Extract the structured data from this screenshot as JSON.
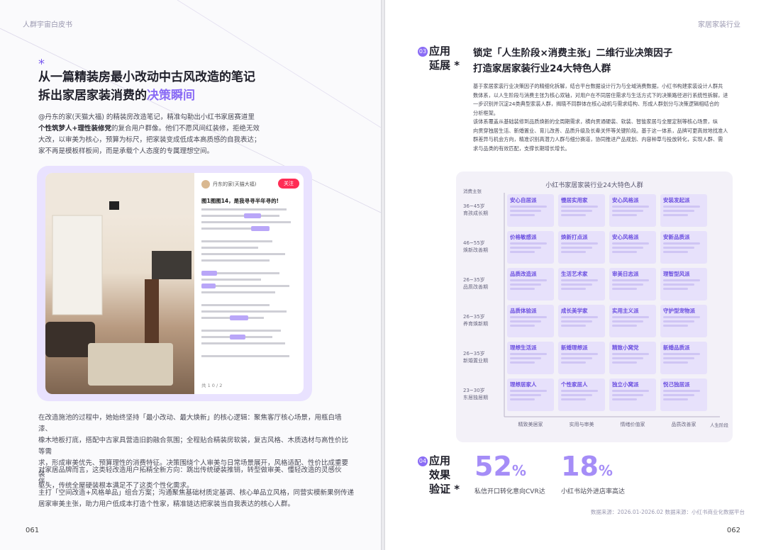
{
  "left_page": {
    "running_head": "人群宇宙白皮书",
    "heading_line1": "从一篇精装房最小改动中古风改造的笔记",
    "heading_line2_plain": "拆出家居家装消费的",
    "heading_line2_accent": "决策瞬间",
    "intro": {
      "p1": "@丹东的家(天猫大福) 的精装房改造笔记，精准勾勒出小红书家居赛道里",
      "p2_bold": "个性筑梦人+理性装修党",
      "p3": "的复合用户群像。他们不愿风间红装修，拒绝无效",
      "p4": "大改，以审美为核心，预算为标尺，把家装变成低成本高质感的自我表达；",
      "p5": "家不再是模板样板间，而是承载个人态度的专属理想空间。"
    },
    "note": {
      "author": "丹东的家(天猫大福)",
      "follow_label": "关注",
      "title": "图1图图14，是我寻寻半年寻的!",
      "footer": "共 1 0 / 2"
    },
    "para2": {
      "l1": "在改造施池的过程中，她始终坚持「最小改动、最大焕新」的核心逻辑：聚焦客厅核心场景，用瓶白墙漆、",
      "l2": "橡木地板打底，搭配中古家具营造旧韵融合氛围；全程贴合精装房软装，复古风格、木质选材与高性价比等需",
      "l3": "求，形成审美优先、预算理性的消费特征。决策围绕个人审美与日常场景展开，风格适配、性价比成重要装",
      "l4": "驱头，传统全屋硬装根本满足不了这类个性化需求。"
    },
    "para3": {
      "l1": "对家居品牌而言，这类轻改造用户拓精全新方向：跳出传统硬装推销，转型做审美、懂轻改造的灵感伙伴，",
      "l2": "主打「空间改造+风格单品」组合方案；沟通聚焦基础材质定基调、核心单品立风格，同营实模新果例传递",
      "l3": "居家审美主张，助力用户低成本打造个性家，精准链达把家装当自我表达的核心人群。"
    },
    "folio": "061"
  },
  "right_page": {
    "running_head": "家居家装行业",
    "sec3": {
      "no": "03",
      "title_l1": "应用",
      "title_l2": "延展 *"
    },
    "title_l1": "锁定「人生阶段×消费主张」二维行业决策因子",
    "title_l2": "打造家居家装行业24大特色人群",
    "body": {
      "l1": "基于家居家装行业决策因子的精细化拆解，结合平台数据设计行为与全域消费数据，小红书构建家装设计人群共",
      "l2": "数体系，以人生阶段与消费主张为核心双轴，对用户在不同居住需求与生活方式下的决策路径进行系统性拆解，进",
      "l3": "一步识别并沉淀24类典型家装人群，揭晓不同群体在核心动机与需求结构、形成人群划分与决策逻辑相结合的",
      "l4": "分析框架。",
      "l5": "该体系覆盖从基础装修到品质焕新的全周期需求，横向贯通硬装、软装、智能家居与全屋定制等核心场景，纵",
      "l6": "向贯穿独居生活、新婚置业、育儿改善、品质升级及长辈关怀等关键阶段。基于这一体系，品牌可更高效地找准人",
      "l7": "群差异与机会方向，精准识别高潜力人群与细分赛道，协同推进产品规划、内容种草与投放转化，实现人群、需",
      "l8": "求与品类的有效匹配，支撑长期增长增长。"
    },
    "grid": {
      "title": "小红书家居家装行业24大特色人群",
      "y_axis_title": "消费主张",
      "x_axis_title": "人生阶段",
      "rows": [
        {
          "label": "36~45岁\n育孩成长期",
          "cells": [
            "安心自居派",
            "慢居实用家",
            "安心风格派",
            "安装发起派"
          ]
        },
        {
          "label": "46~55岁\n焕新改善期",
          "cells": [
            "价格敏感派",
            "焕新打点派",
            "安心风格派",
            "安新品质派"
          ]
        },
        {
          "label": "26~35岁\n品质改善期",
          "cells": [
            "品质改造派",
            "生活艺术家",
            "审美日志派",
            "理智型风派"
          ]
        },
        {
          "label": "26~35岁\n养育焕新期",
          "cells": [
            "品质体验派",
            "成长美学家",
            "实用主义派",
            "守护型宠物派"
          ]
        },
        {
          "label": "26~35岁\n新婚置业期",
          "cells": [
            "理想生活派",
            "新婚理想派",
            "精致小窝党",
            "新婚品质派"
          ]
        },
        {
          "label": "23~30岁\n东居独居期",
          "cells": [
            "理想居家人",
            "个性家居人",
            "独立小窝派",
            "悦己独居派"
          ]
        }
      ],
      "columns": [
        "精致美居家",
        "实用与审美",
        "情绪价值家",
        "品质改善家"
      ]
    },
    "sec4": {
      "no": "04",
      "title_l1": "应用",
      "title_l2": "效果",
      "title_l3": "验证 *"
    },
    "stat1": {
      "value": "52",
      "unit": "%",
      "caption": "私信开口转化意向CVR达"
    },
    "stat2": {
      "value": "18",
      "unit": "%",
      "caption": "小红书站外进店率高达"
    },
    "source": "数据来源：2026.01-2026.02  数据来源：小红书商业化数据平台",
    "folio": "062"
  },
  "colors": {
    "accent": "#8a6cf5",
    "stat": "#a58df7",
    "cell_bg": "#e7e1fb"
  }
}
